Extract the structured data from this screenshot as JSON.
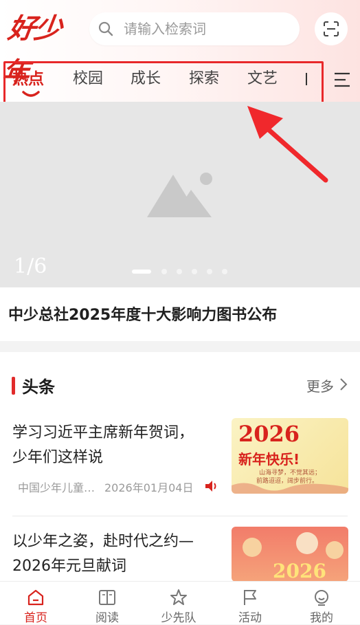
{
  "header": {
    "logo_text": "好少年",
    "search_placeholder": "请输入检索词"
  },
  "tabs": [
    {
      "label": "热点",
      "active": true
    },
    {
      "label": "校园",
      "active": false
    },
    {
      "label": "成长",
      "active": false
    },
    {
      "label": "探索",
      "active": false
    },
    {
      "label": "文艺",
      "active": false
    }
  ],
  "banner": {
    "counter": "1/6",
    "slide_count": 6,
    "active_slide": 1,
    "headline": "中少总社2025年度十大影响力图书公布"
  },
  "section": {
    "title": "头条",
    "more_label": "更多"
  },
  "news": [
    {
      "title_line1": "学习习近平主席新年贺词，",
      "title_line2": "少年们这样说",
      "source": "中国少年儿童…",
      "date": "2026年01月04日",
      "has_audio": true,
      "thumb_year": "2026",
      "thumb_text": "新年快乐!",
      "thumb_sub1": "山海寻梦，不觉其远；",
      "thumb_sub2": "前路迢迢，阔步前行。"
    },
    {
      "title_line1": "以少年之姿，赴时代之约—",
      "title_line2": "2026年元旦献词",
      "thumb_year": "2026"
    }
  ],
  "tabbar": [
    {
      "label": "首页",
      "icon": "home-icon",
      "active": true
    },
    {
      "label": "阅读",
      "icon": "book-icon",
      "active": false
    },
    {
      "label": "少先队",
      "icon": "star-icon",
      "active": false
    },
    {
      "label": "活动",
      "icon": "flag-icon",
      "active": false
    },
    {
      "label": "我的",
      "icon": "user-icon",
      "active": false
    }
  ],
  "colors": {
    "accent": "#d8231d",
    "annotation": "#e8282a"
  }
}
